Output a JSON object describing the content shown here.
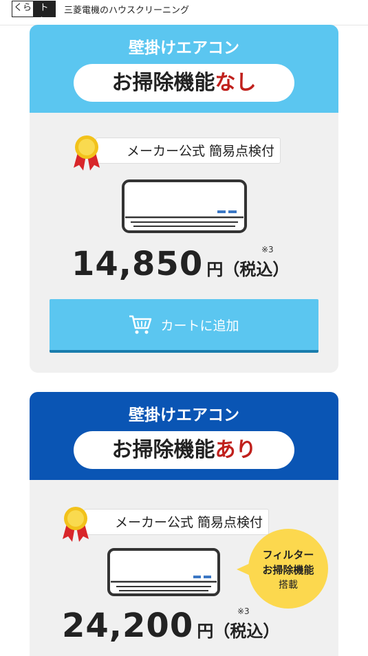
{
  "header": {
    "logo_left": "くら",
    "logo_right": "トク°",
    "title": "三菱電機のハウスクリーニング"
  },
  "products": [
    {
      "category": "壁掛けエアコン",
      "pill_main": "お掃除機能",
      "pill_accent": "なし",
      "badge": "メーカー公式 簡易点検付",
      "price_number": "14,850",
      "price_unit": "円（税込）",
      "note": "※3",
      "cart_label": "カートに追加"
    },
    {
      "category": "壁掛けエアコン",
      "pill_main": "お掃除機能",
      "pill_accent": "あり",
      "badge": "メーカー公式 簡易点検付",
      "price_number": "24,200",
      "price_unit": "円（税込）",
      "note": "※3",
      "bubble_line1": "フィルター",
      "bubble_line2": "お掃除機能",
      "bubble_line3": "搭載"
    }
  ],
  "colors": {
    "light_blue": "#5bc6f0",
    "dark_blue": "#0a55b4",
    "accent_red": "#c0201c",
    "bubble_yellow": "#fcd84e"
  }
}
